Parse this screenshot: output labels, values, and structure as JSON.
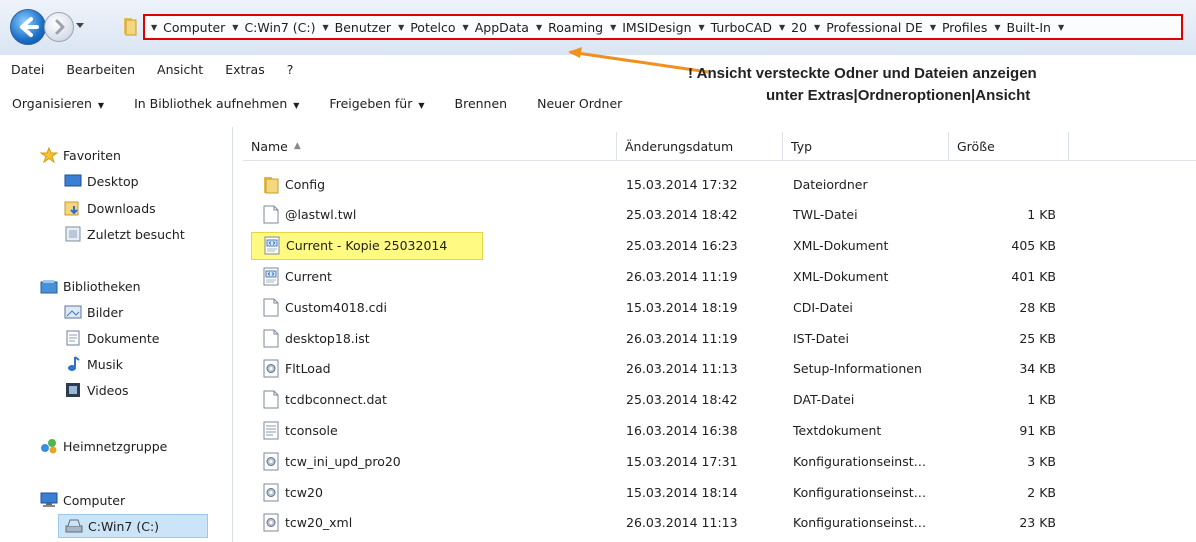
{
  "breadcrumb": [
    "Computer",
    "C:Win7 (C:)",
    "Benutzer",
    "Potelco",
    "AppData",
    "Roaming",
    "IMSIDesign",
    "TurboCAD",
    "20",
    "Professional DE",
    "Profiles",
    "Built-In"
  ],
  "menu": [
    "Datei",
    "Bearbeiten",
    "Ansicht",
    "Extras",
    "?"
  ],
  "toolbar": {
    "organize": "Organisieren",
    "library": "In Bibliothek aufnehmen",
    "share": "Freigeben für",
    "burn": "Brennen",
    "new_folder": "Neuer Ordner"
  },
  "annotation": {
    "line1": "! Ansicht versteckte Odner und Dateien anzeigen",
    "line2": "unter Extras|Ordneroptionen|Ansicht"
  },
  "sidebar": {
    "favorites": "Favoriten",
    "desktop": "Desktop",
    "downloads": "Downloads",
    "recent": "Zuletzt besucht",
    "libraries": "Bibliotheken",
    "pictures": "Bilder",
    "documents": "Dokumente",
    "music": "Musik",
    "videos": "Videos",
    "homegroup": "Heimnetzgruppe",
    "computer": "Computer",
    "drive": "C:Win7 (C:)"
  },
  "columns": {
    "name": "Name",
    "date": "Änderungsdatum",
    "type": "Typ",
    "size": "Größe"
  },
  "files": [
    {
      "name": "Config",
      "date": "15.03.2014 17:32",
      "type": "Dateiordner",
      "size": "",
      "icon": "folder-icon"
    },
    {
      "name": "@lastwl.twl",
      "date": "25.03.2014 18:42",
      "type": "TWL-Datei",
      "size": "1 KB",
      "icon": "file-icon"
    },
    {
      "name": "Current - Kopie 25032014",
      "date": "25.03.2014 16:23",
      "type": "XML-Dokument",
      "size": "405 KB",
      "icon": "xml-icon"
    },
    {
      "name": "Current",
      "date": "26.03.2014 11:19",
      "type": "XML-Dokument",
      "size": "401 KB",
      "icon": "xml-icon"
    },
    {
      "name": "Custom4018.cdi",
      "date": "15.03.2014 18:19",
      "type": "CDI-Datei",
      "size": "28 KB",
      "icon": "file-icon"
    },
    {
      "name": "desktop18.ist",
      "date": "26.03.2014 11:19",
      "type": "IST-Datei",
      "size": "25 KB",
      "icon": "file-icon"
    },
    {
      "name": "FltLoad",
      "date": "26.03.2014 11:13",
      "type": "Setup-Informationen",
      "size": "34 KB",
      "icon": "config-icon"
    },
    {
      "name": "tcdbconnect.dat",
      "date": "25.03.2014 18:42",
      "type": "DAT-Datei",
      "size": "1 KB",
      "icon": "file-icon"
    },
    {
      "name": "tconsole",
      "date": "16.03.2014 16:38",
      "type": "Textdokument",
      "size": "91 KB",
      "icon": "text-icon"
    },
    {
      "name": "tcw_ini_upd_pro20",
      "date": "15.03.2014 17:31",
      "type": "Konfigurationseinst…",
      "size": "3 KB",
      "icon": "config-icon"
    },
    {
      "name": "tcw20",
      "date": "15.03.2014 18:14",
      "type": "Konfigurationseinst…",
      "size": "2 KB",
      "icon": "config-icon"
    },
    {
      "name": "tcw20_xml",
      "date": "26.03.2014 11:13",
      "type": "Konfigurationseinst…",
      "size": "23 KB",
      "icon": "config-icon"
    }
  ],
  "highlight_row": "Current - Kopie 25032014",
  "colors": {
    "annotation_border": "#e00000",
    "highlight": "#fffa82",
    "arrow": "#f0901e"
  }
}
